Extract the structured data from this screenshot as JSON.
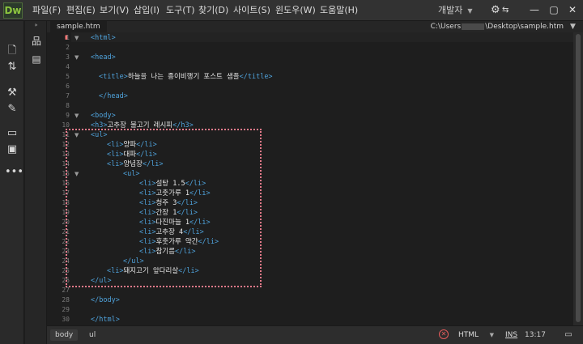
{
  "app": {
    "logo": "Dw"
  },
  "menu": [
    "파일(F)",
    "편집(E)",
    "보기(V)",
    "삽입(I)",
    "도구(T)",
    "찾기(D)",
    "사이트(S)",
    "윈도우(W)",
    "도움말(H)"
  ],
  "workspace": {
    "label": "개발자"
  },
  "document": {
    "tab": "sample.htm",
    "path_prefix": "C:\\Users",
    "path_suffix": "\\Desktop\\sample.htm"
  },
  "editor": {
    "line_numbers": [
      "1",
      "2",
      "3",
      "4",
      "5",
      "6",
      "7",
      "8",
      "9",
      "10",
      "11",
      "12",
      "13",
      "14",
      "15",
      "16",
      "17",
      "18",
      "19",
      "20",
      "21",
      "22",
      "23",
      "24",
      "25",
      "26",
      "27",
      "28",
      "29",
      "30"
    ],
    "lines": [
      {
        "tag1": "<html>",
        "text": "",
        "tag2": ""
      },
      {
        "tag1": "",
        "text": "",
        "tag2": ""
      },
      {
        "tag1": "<head>",
        "text": "",
        "tag2": ""
      },
      {
        "tag1": "",
        "text": "",
        "tag2": ""
      },
      {
        "tag1": "<title>",
        "text": "하늘을 나는 종이비행기 포스트 샘플",
        "tag2": "</title>"
      },
      {
        "tag1": "",
        "text": "",
        "tag2": ""
      },
      {
        "tag1": "</head>",
        "text": "",
        "tag2": ""
      },
      {
        "tag1": "",
        "text": "",
        "tag2": ""
      },
      {
        "tag1": "<body>",
        "text": "",
        "tag2": ""
      },
      {
        "tag1": "<h3>",
        "text": "고추장 불고기 레시피",
        "tag2": "</h3>"
      },
      {
        "tag1": "<ul>",
        "text": "",
        "tag2": ""
      },
      {
        "tag1": "<li>",
        "text": "양파",
        "tag2": "</li>"
      },
      {
        "tag1": "<li>",
        "text": "대파",
        "tag2": "</li>"
      },
      {
        "tag1": "<li>",
        "text": "양념장",
        "tag2": "</li>"
      },
      {
        "tag1": "<ul>",
        "text": "",
        "tag2": ""
      },
      {
        "tag1": "<li>",
        "text": "설탕 1.5",
        "tag2": "</li>"
      },
      {
        "tag1": "<li>",
        "text": "고춧가루 1",
        "tag2": "</li>"
      },
      {
        "tag1": "<li>",
        "text": "청주 3",
        "tag2": "</li>"
      },
      {
        "tag1": "<li>",
        "text": "간장 1",
        "tag2": "</li>"
      },
      {
        "tag1": "<li>",
        "text": "다진마늘 1",
        "tag2": "</li>"
      },
      {
        "tag1": "<li>",
        "text": "고추장 4",
        "tag2": "</li>"
      },
      {
        "tag1": "<li>",
        "text": "후춧가루 약간",
        "tag2": "</li>"
      },
      {
        "tag1": "<li>",
        "text": "참기름",
        "tag2": "</li>"
      },
      {
        "tag1": "</ul>",
        "text": "",
        "tag2": ""
      },
      {
        "tag1": "<li>",
        "text": "돼지고기 앞다리살",
        "tag2": "</li>"
      },
      {
        "tag1": "</ul>",
        "text": "",
        "tag2": ""
      },
      {
        "tag1": "",
        "text": "",
        "tag2": ""
      },
      {
        "tag1": "</body>",
        "text": "",
        "tag2": ""
      },
      {
        "tag1": "",
        "text": "",
        "tag2": ""
      },
      {
        "tag1": "</html>",
        "text": "",
        "tag2": ""
      }
    ]
  },
  "statusbar": {
    "crumbs": [
      "body",
      "ul"
    ],
    "language": "HTML",
    "mode": "INS",
    "position": "13:17"
  },
  "icons": {
    "settings": "gear-icon",
    "sync": "sync-icon",
    "error": "error-icon"
  }
}
